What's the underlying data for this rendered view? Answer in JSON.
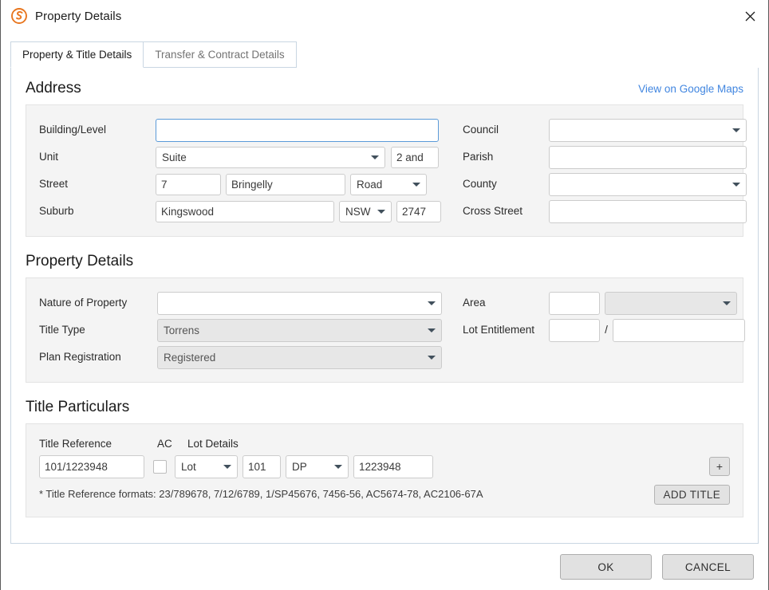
{
  "window": {
    "title": "Property Details",
    "logo_icon": "spiral-s-logo-icon",
    "close_icon": "close-icon",
    "accent_color": "#e8761f",
    "link_color": "#4186e0",
    "focus_border_color": "#5b9ad8"
  },
  "tabs": [
    {
      "label": "Property & Title Details",
      "active": true
    },
    {
      "label": "Transfer & Contract Details",
      "active": false
    }
  ],
  "address": {
    "heading": "Address",
    "maps_link": "View on Google Maps",
    "labels": {
      "building_level": "Building/Level",
      "unit": "Unit",
      "street": "Street",
      "suburb": "Suburb",
      "council": "Council",
      "parish": "Parish",
      "county": "County",
      "cross_street": "Cross Street"
    },
    "values": {
      "building_level": "",
      "unit_type": "Suite",
      "unit_number": "2 and",
      "street_number": "7",
      "street_name": "Bringelly",
      "street_type": "Road",
      "suburb": "Kingswood",
      "state": "NSW",
      "postcode": "2747",
      "council": "",
      "parish": "",
      "county": "",
      "cross_street": ""
    }
  },
  "property_details": {
    "heading": "Property Details",
    "labels": {
      "nature_of_property": "Nature of Property",
      "title_type": "Title Type",
      "plan_registration": "Plan Registration",
      "area": "Area",
      "lot_entitlement": "Lot Entitlement",
      "separator": "/"
    },
    "values": {
      "nature_of_property": "",
      "title_type": "Torrens",
      "plan_registration": "Registered",
      "area_value": "",
      "area_unit": "",
      "lot_entitlement_numerator": "",
      "lot_entitlement_denominator": ""
    }
  },
  "title_particulars": {
    "heading": "Title Particulars",
    "columns": {
      "title_reference": "Title Reference",
      "ac": "AC",
      "lot_details": "Lot Details"
    },
    "row": {
      "title_reference": "101/1223948",
      "ac_checked": false,
      "lot_label": "Lot",
      "lot_number": "101",
      "plan_label": "DP",
      "plan_number": "1223948"
    },
    "add_row_button": "+",
    "add_title_button": "ADD TITLE",
    "hint": "* Title Reference formats: 23/789678, 7/12/6789, 1/SP45676, 7456-56, AC5674-78, AC2106-67A"
  },
  "footer": {
    "ok_label": "OK",
    "cancel_label": "CANCEL"
  }
}
